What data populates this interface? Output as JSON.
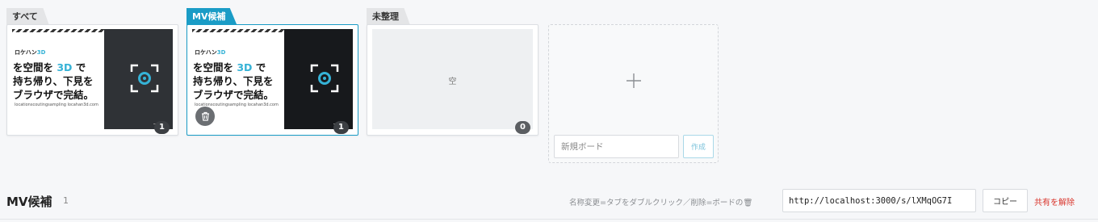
{
  "boards": [
    {
      "tab": "すべて",
      "count": "1",
      "thumbnail": {
        "brand": "ロケハン",
        "brand_accent": "3D",
        "line1_a": "を空間を ",
        "line1_hl": "3D",
        "line1_b": " で",
        "line2": "持ち帰り、下見を",
        "line3": "ブラウザで完結。",
        "url": "locationscoutingsampling   locahan3d.com"
      }
    },
    {
      "tab": "MV候補",
      "count": "1",
      "thumbnail": {
        "brand": "ロケハン",
        "brand_accent": "3D",
        "line1_a": "を空間を ",
        "line1_hl": "3D",
        "line1_b": " で",
        "line2": "持ち帰り、下見を",
        "line3": "ブラウザで完結。",
        "url": "locationscoutingsampling   locahan3d.com"
      }
    },
    {
      "tab": "未整理",
      "count": "0",
      "empty_label": "空"
    }
  ],
  "new_board": {
    "placeholder": "新規ボード",
    "create_label": "作成"
  },
  "section": {
    "title": "MV候補",
    "count": "1",
    "hint": "名称変更=タブをダブルクリック／削除=ボードの🗑",
    "share_url": "http://localhost:3000/s/lXMqOG7I",
    "copy_label": "コピー",
    "unshare_label": "共有を解除"
  },
  "colors": {
    "accent": "#1a9cc6",
    "danger": "#d9342b",
    "thumb_highlight": "#35b2d6"
  },
  "icons": {
    "scan": "scan-frame-icon",
    "trash": "trash-icon",
    "plus": "plus-icon"
  }
}
